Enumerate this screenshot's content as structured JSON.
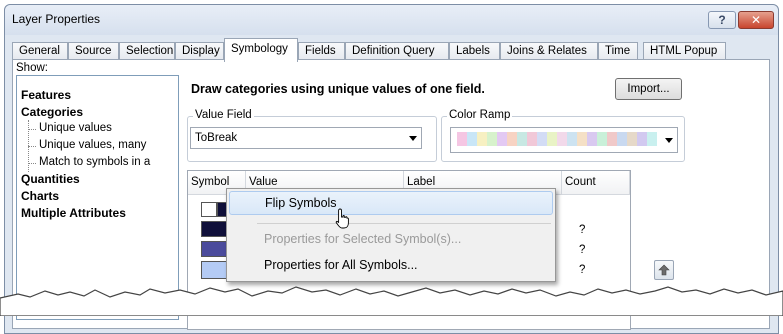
{
  "window": {
    "title": "Layer Properties",
    "help_label": "?",
    "close_label": "✕"
  },
  "tabs": [
    {
      "label": "General"
    },
    {
      "label": "Source"
    },
    {
      "label": "Selection"
    },
    {
      "label": "Display"
    },
    {
      "label": "Symbology",
      "active": true
    },
    {
      "label": "Fields"
    },
    {
      "label": "Definition Query"
    },
    {
      "label": "Labels"
    },
    {
      "label": "Joins & Relates"
    },
    {
      "label": "Time"
    },
    {
      "label": "HTML Popup"
    }
  ],
  "show_panel": {
    "label": "Show:",
    "items": [
      {
        "label": "Features"
      },
      {
        "label": "Categories"
      },
      {
        "label": "Unique values"
      },
      {
        "label": "Unique values, many"
      },
      {
        "label": "Match to symbols in a"
      },
      {
        "label": "Quantities"
      },
      {
        "label": "Charts"
      },
      {
        "label": "Multiple Attributes"
      }
    ]
  },
  "symbology": {
    "description": "Draw categories using unique values of one field.",
    "import_label": "Import...",
    "value_field": {
      "label": "Value Field",
      "value": "ToBreak"
    },
    "color_ramp": {
      "label": "Color Ramp"
    },
    "ramp_colors": [
      "#f5c6e3",
      "#c9e6f7",
      "#f7f0c2",
      "#d7f2cc",
      "#e3c9f3",
      "#f7d3c3",
      "#c8e8e3",
      "#f1c8d8",
      "#d3dcf5",
      "#e9f3c6",
      "#f2d9ea",
      "#cde3f1",
      "#f5e0c6",
      "#d9c9f0",
      "#c9f0d9",
      "#f0c9c9",
      "#c9d9f0",
      "#e6d9c9",
      "#d2c9f0",
      "#c9f0ef"
    ],
    "columns": {
      "symbol": "Symbol",
      "value": "Value",
      "label": "Label",
      "count": "Count"
    },
    "rows": [
      {
        "color": "#ffffff",
        "count": ""
      },
      {
        "color": "#10103a",
        "count": "?"
      },
      {
        "color": "#4b4b9c",
        "count": "?"
      },
      {
        "color": "#b4cbf5",
        "count": "?"
      }
    ]
  },
  "context_menu": {
    "items": [
      {
        "label": "Flip Symbols",
        "state": "hover"
      },
      {
        "label": "Properties for Selected Symbol(s)...",
        "state": "disabled"
      },
      {
        "label": "Properties for All Symbols...",
        "state": "normal"
      }
    ]
  }
}
